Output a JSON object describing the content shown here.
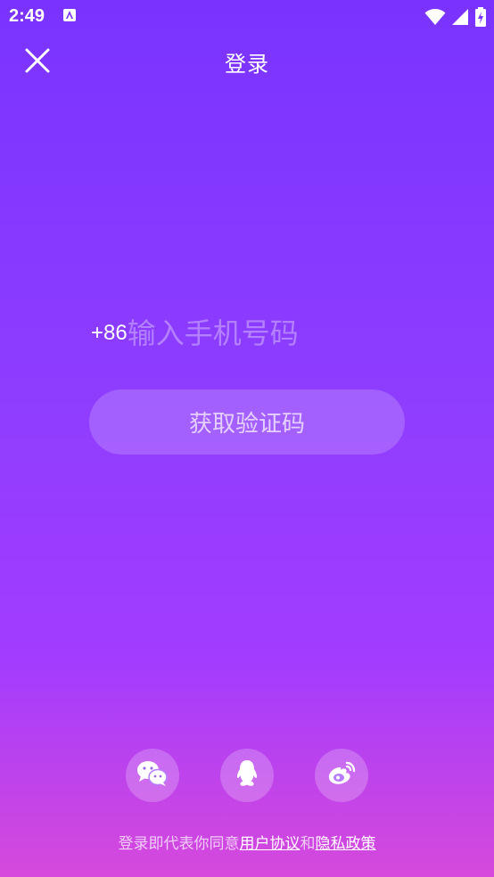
{
  "status_bar": {
    "time": "2:49",
    "notification_icon": "app-notification-icon",
    "wifi_icon": "wifi-icon",
    "signal_icon": "cell-signal-icon",
    "battery_icon": "battery-charging-icon"
  },
  "header": {
    "title": "登录",
    "close_icon": "close-icon"
  },
  "login": {
    "country_code": "+86",
    "phone_placeholder": "输入手机号码",
    "phone_value": "",
    "get_code_label": "获取验证码"
  },
  "social": [
    {
      "name": "wechat",
      "icon": "wechat-icon"
    },
    {
      "name": "qq",
      "icon": "qq-icon"
    },
    {
      "name": "weibo",
      "icon": "weibo-icon"
    }
  ],
  "agreement": {
    "prefix": "登录即代表你同意",
    "user_agreement": "用户协议",
    "and": "和",
    "privacy_policy": "隐私政策"
  },
  "colors": {
    "gradient_top": "#7a33ff",
    "gradient_bottom": "#d649db"
  }
}
